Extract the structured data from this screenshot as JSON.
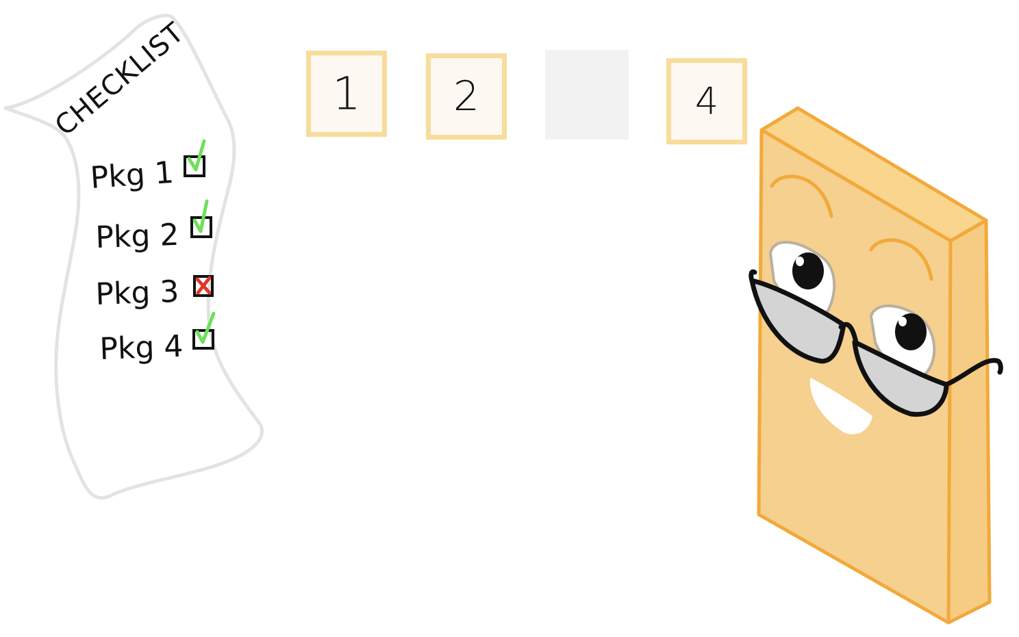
{
  "checklist": {
    "title": "CHECKLIST",
    "items": [
      {
        "label": "Pkg 1",
        "status": "checked"
      },
      {
        "label": "Pkg 2",
        "status": "checked"
      },
      {
        "label": "Pkg 3",
        "status": "crossed"
      },
      {
        "label": "Pkg 4",
        "status": "checked"
      }
    ]
  },
  "packages": [
    {
      "number": "1",
      "state": "present"
    },
    {
      "number": "2",
      "state": "present"
    },
    {
      "number": "",
      "state": "missing"
    },
    {
      "number": "4",
      "state": "present"
    }
  ],
  "colors": {
    "paper_outline": "#e3e3e3",
    "check_green": "#6ee05a",
    "cross_red": "#e0352b",
    "box_border": "#f7dc9c",
    "box_fill": "#fdf9f2",
    "empty_slot": "#f2f2f2",
    "character_body": "#f5d08e",
    "character_outline": "#f2a93b",
    "glasses_lens": "#d4d4d4"
  },
  "icons": {
    "checklist": "paper-checklist-icon",
    "check": "checkmark-icon",
    "cross": "x-mark-icon",
    "character": "glasses-block-character"
  }
}
